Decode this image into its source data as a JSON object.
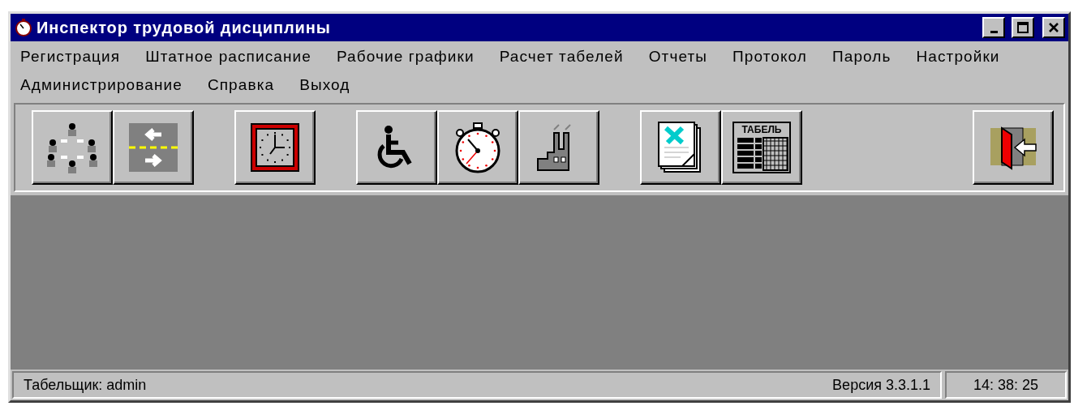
{
  "window": {
    "title": "Инспектор трудовой дисциплины"
  },
  "menu": [
    {
      "label": "Регистрация"
    },
    {
      "label": "Штатное расписание"
    },
    {
      "label": "Рабочие графики"
    },
    {
      "label": "Расчет табелей"
    },
    {
      "label": "Отчеты"
    },
    {
      "label": "Протокол"
    },
    {
      "label": "Пароль"
    },
    {
      "label": "Настройки"
    },
    {
      "label": "Администрирование"
    },
    {
      "label": "Справка"
    },
    {
      "label": "Выход"
    }
  ],
  "toolbar": {
    "groups": [
      {
        "buttons": [
          {
            "kind": "people"
          },
          {
            "kind": "arrows"
          }
        ]
      },
      {
        "buttons": [
          {
            "kind": "clock"
          }
        ]
      },
      {
        "buttons": [
          {
            "kind": "wheelchair"
          },
          {
            "kind": "stopwatch"
          },
          {
            "kind": "factory"
          }
        ]
      },
      {
        "buttons": [
          {
            "kind": "document"
          },
          {
            "kind": "timesheet",
            "label": "ТАБЕЛЬ"
          }
        ]
      },
      {
        "buttons": [
          {
            "kind": "exit"
          }
        ]
      }
    ]
  },
  "status_bar": {
    "user": "Табельщик: admin",
    "version": "Версия 3.3.1.1",
    "time": "14: 38: 25"
  }
}
